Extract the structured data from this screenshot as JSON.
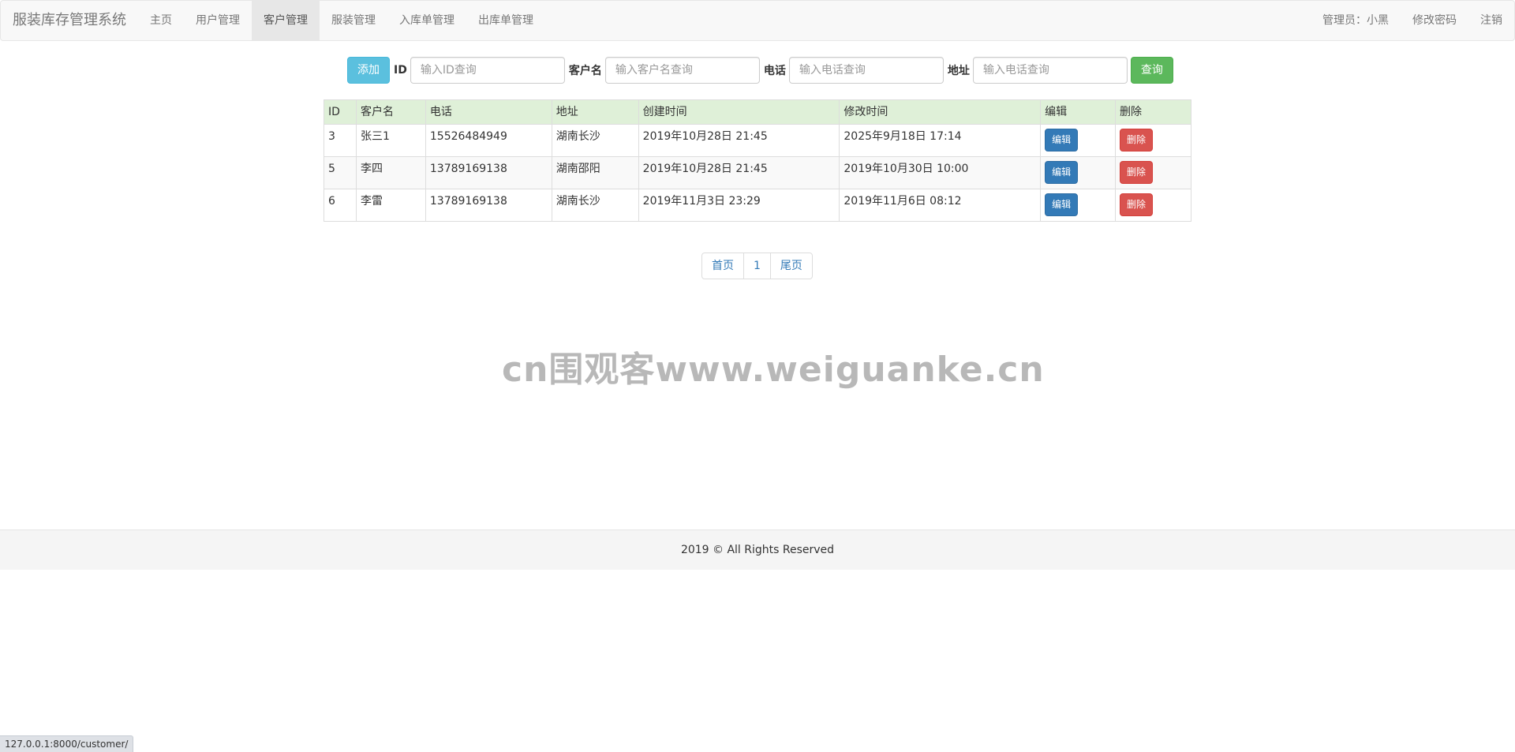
{
  "navbar": {
    "brand": "服装库存管理系统",
    "items": [
      {
        "label": "主页",
        "active": false
      },
      {
        "label": "用户管理",
        "active": false
      },
      {
        "label": "客户管理",
        "active": true
      },
      {
        "label": "服装管理",
        "active": false
      },
      {
        "label": "入库单管理",
        "active": false
      },
      {
        "label": "出库单管理",
        "active": false
      }
    ],
    "right": {
      "admin": "管理员：小黑",
      "change_password": "修改密码",
      "logout": "注销"
    }
  },
  "search": {
    "add_button": "添加",
    "id_label": "ID",
    "id_placeholder": "输入ID查询",
    "name_label": "客户名",
    "name_placeholder": "输入客户名查询",
    "phone_label": "电话",
    "phone_placeholder": "输入电话查询",
    "address_label": "地址",
    "address_placeholder": "输入电话查询",
    "query_button": "查询"
  },
  "table": {
    "headers": [
      "ID",
      "客户名",
      "电话",
      "地址",
      "创建时间",
      "修改时间",
      "编辑",
      "删除"
    ],
    "edit_label": "编辑",
    "delete_label": "删除",
    "rows": [
      {
        "id": "3",
        "name": "张三1",
        "phone": "15526484949",
        "address": "湖南长沙",
        "created": "2019年10月28日 21:45",
        "modified": "2025年9月18日 17:14"
      },
      {
        "id": "5",
        "name": "李四",
        "phone": "13789169138",
        "address": "湖南邵阳",
        "created": "2019年10月28日 21:45",
        "modified": "2019年10月30日 10:00"
      },
      {
        "id": "6",
        "name": "李雷",
        "phone": "13789169138",
        "address": "湖南长沙",
        "created": "2019年11月3日 23:29",
        "modified": "2019年11月6日 08:12"
      }
    ]
  },
  "pagination": {
    "first": "首页",
    "page": "1",
    "last": "尾页"
  },
  "watermark": "cn围观客www.weiguanke.cn",
  "footer": {
    "text": "2019 © All Rights Reserved"
  },
  "status_bar": {
    "url": "127.0.0.1:8000/customer/"
  }
}
